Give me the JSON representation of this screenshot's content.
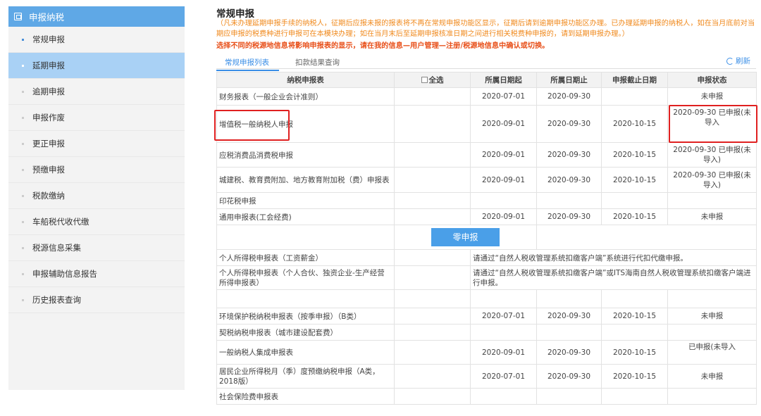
{
  "sidebar": {
    "header": "申报纳税",
    "items": [
      {
        "label": "常规申报"
      },
      {
        "label": "延期申报"
      },
      {
        "label": "逾期申报"
      },
      {
        "label": "申报作废"
      },
      {
        "label": "更正申报"
      },
      {
        "label": "预缴申报"
      },
      {
        "label": "税款缴纳"
      },
      {
        "label": "车船税代收代缴"
      },
      {
        "label": "税源信息采集"
      },
      {
        "label": "申报辅助信息报告"
      },
      {
        "label": "历史报表查询"
      }
    ]
  },
  "main": {
    "title": "常规申报",
    "notice": "（凡未办理延期申报手续的纳税人，征期后应报未报的报表将不再在常规申报功能区显示，征期后请到逾期申报功能区办理。已办理延期申报的纳税人，如在当月底前对当期应申报的税费种进行申报可在本模块办理；如在当月末后至延期申报核准日期之间进行相关税费种申报的，请到延期申报办理。）",
    "notice2_pre": "选择不同的税源地信息将影响申报表的显示，请在",
    "notice2_link": "我的信息—用户管理—注册/税源地信息",
    "notice2_post": "中确认或切换。",
    "tabs": [
      "常规申报列表",
      "扣款结果查询"
    ],
    "refresh": "刷新",
    "table": {
      "headers": [
        "纳税申报表",
        "全选",
        "所属日期起",
        "所属日期止",
        "申报截止日期",
        "申报状态"
      ],
      "rows": [
        {
          "name": "财务报表（一般企业会计准则）",
          "start": "2020-07-01",
          "end": "2020-09-30",
          "deadline": "",
          "status": "未申报"
        },
        {
          "name": "增值税一般纳税人申报",
          "start": "2020-09-01",
          "end": "2020-09-30",
          "deadline": "2020-10-15",
          "status": "2020-09-30 已申报(未导入"
        },
        {
          "name": "应税消费品消费税申报",
          "start": "2020-09-01",
          "end": "2020-09-30",
          "deadline": "2020-10-15",
          "status": "2020-09-30 已申报(未导入)"
        },
        {
          "name": "城建税、教育费附加、地方教育附加税（费）申报表",
          "start": "2020-09-01",
          "end": "2020-09-30",
          "deadline": "2020-10-15",
          "status": "2020-09-30 已申报(未导入)"
        },
        {
          "name": "印花税申报",
          "start": "",
          "end": "",
          "deadline": "",
          "status": ""
        },
        {
          "name": "通用申报表(工会经费)",
          "start": "2020-09-01",
          "end": "2020-09-30",
          "deadline": "2020-10-15",
          "status": "未申报"
        }
      ],
      "zero_button": "零申报",
      "personal_rows": [
        {
          "name": "个人所得税申报表（工资薪金）",
          "note": "请通过“自然人税收管理系统扣缴客户端”系统进行代扣代缴申报。"
        },
        {
          "name": "个人所得税申报表（个人合伙、独资企业-生产经营所得申报表）",
          "note": "请通过“自然人税收管理系统扣缴客户端”或ITS海南自然人税收管理系统扣缴客户端进行申报。"
        }
      ],
      "rows2": [
        {
          "name": "环境保护税纳税申报表（按季申报）（B类）",
          "start": "2020-07-01",
          "end": "2020-09-30",
          "deadline": "2020-10-15",
          "status": "未申报"
        },
        {
          "name": "契税纳税申报表（城市建设配套费）",
          "start": "",
          "end": "",
          "deadline": "",
          "status": ""
        },
        {
          "name": "一般纳税人集成申报表",
          "start": "2020-09-01",
          "end": "2020-09-30",
          "deadline": "2020-10-15",
          "status": "已申报(未导入"
        },
        {
          "name": "居民企业所得税月（季）度预缴纳税申报（A类，2018版）",
          "start": "2020-07-01",
          "end": "2020-09-30",
          "deadline": "2020-10-15",
          "status": "未申报"
        },
        {
          "name": "社会保险费申报表",
          "start": "",
          "end": "",
          "deadline": "",
          "status": ""
        }
      ]
    }
  }
}
